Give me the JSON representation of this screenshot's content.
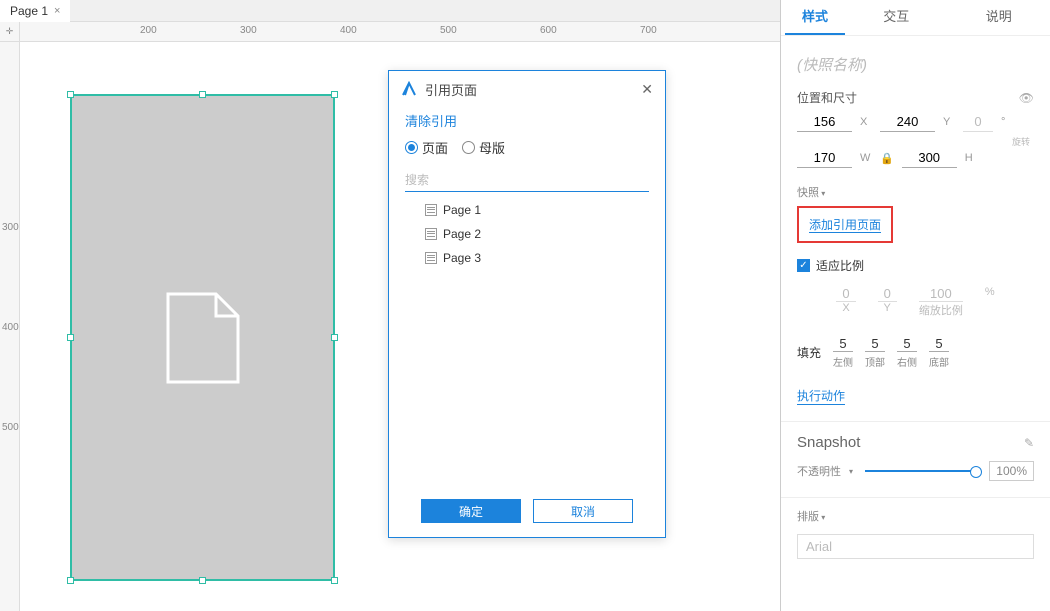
{
  "tab": {
    "name": "Page 1"
  },
  "ruler": {
    "h": [
      "200",
      "300",
      "400",
      "500",
      "600",
      "700"
    ],
    "v": [
      "300",
      "400",
      "500"
    ]
  },
  "dialog": {
    "title": "引用页面",
    "clear": "清除引用",
    "radio_page": "页面",
    "radio_master": "母版",
    "search_placeholder": "搜索",
    "pages": [
      "Page 1",
      "Page 2",
      "Page 3"
    ],
    "ok": "确定",
    "cancel": "取消"
  },
  "panel": {
    "tabs": {
      "style": "样式",
      "interact": "交互",
      "notes": "说明"
    },
    "name_placeholder": "(快照名称)",
    "pos_section": "位置和尺寸",
    "x": "156",
    "xl": "X",
    "y": "240",
    "yl": "Y",
    "rot": "0",
    "rotu": "°",
    "rotl": "旋转",
    "w": "170",
    "wl": "W",
    "h": "300",
    "hl": "H",
    "snap_section": "快照",
    "add_ref": "添加引用页面",
    "fit": "适应比例",
    "sx": "0",
    "sxl": "X",
    "sy": "0",
    "syl": "Y",
    "scale": "100",
    "scaleu": "%",
    "scalel": "缩放比例",
    "fill_label": "填充",
    "pad": {
      "l": {
        "v": "5",
        "l": "左侧"
      },
      "t": {
        "v": "5",
        "l": "顶部"
      },
      "r": {
        "v": "5",
        "l": "右侧"
      },
      "b": {
        "v": "5",
        "l": "底部"
      }
    },
    "action": "执行动作",
    "snapshot": "Snapshot",
    "opacity_label": "不透明性",
    "opacity": "100%",
    "typo": "排版",
    "font": "Arial"
  }
}
